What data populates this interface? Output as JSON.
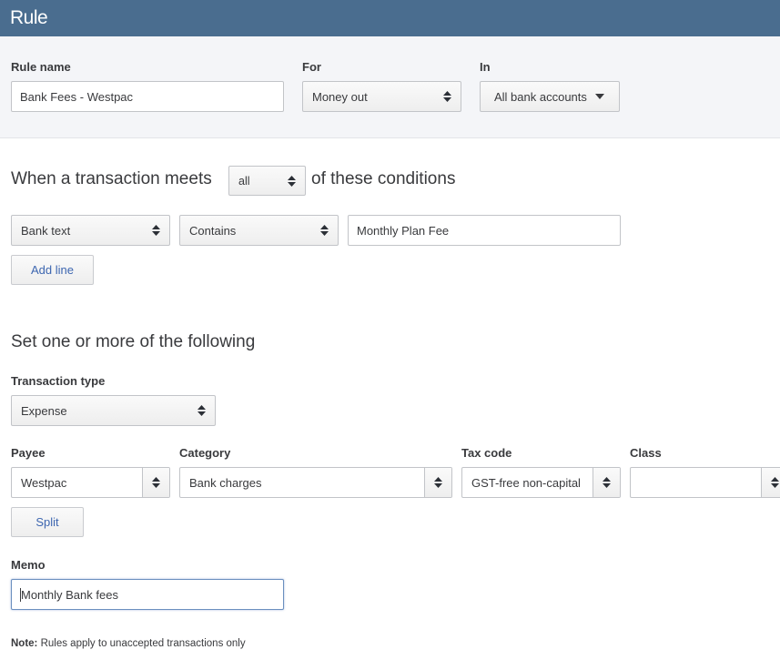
{
  "header": {
    "title": "Rule"
  },
  "top": {
    "rule_name_label": "Rule name",
    "rule_name_value": "Bank Fees - Westpac",
    "for_label": "For",
    "for_value": "Money out",
    "in_label": "In",
    "in_value": "All bank accounts"
  },
  "conditions": {
    "heading_prefix": "When a transaction meets",
    "match_value": "all",
    "heading_suffix": "of these conditions",
    "field_value": "Bank text",
    "operator_value": "Contains",
    "text_value": "Monthly Plan Fee",
    "add_line_label": "Add line"
  },
  "actions": {
    "heading": "Set one or more of the following",
    "transaction_type_label": "Transaction type",
    "transaction_type_value": "Expense",
    "payee_label": "Payee",
    "payee_value": "Westpac",
    "category_label": "Category",
    "category_value": "Bank charges",
    "tax_code_label": "Tax code",
    "tax_code_value": "GST-free non-capital",
    "class_label": "Class",
    "class_value": "",
    "split_label": "Split",
    "memo_label": "Memo",
    "memo_value": "Monthly Bank fees"
  },
  "note": {
    "prefix": "Note:",
    "text": " Rules apply to unaccepted transactions only"
  }
}
